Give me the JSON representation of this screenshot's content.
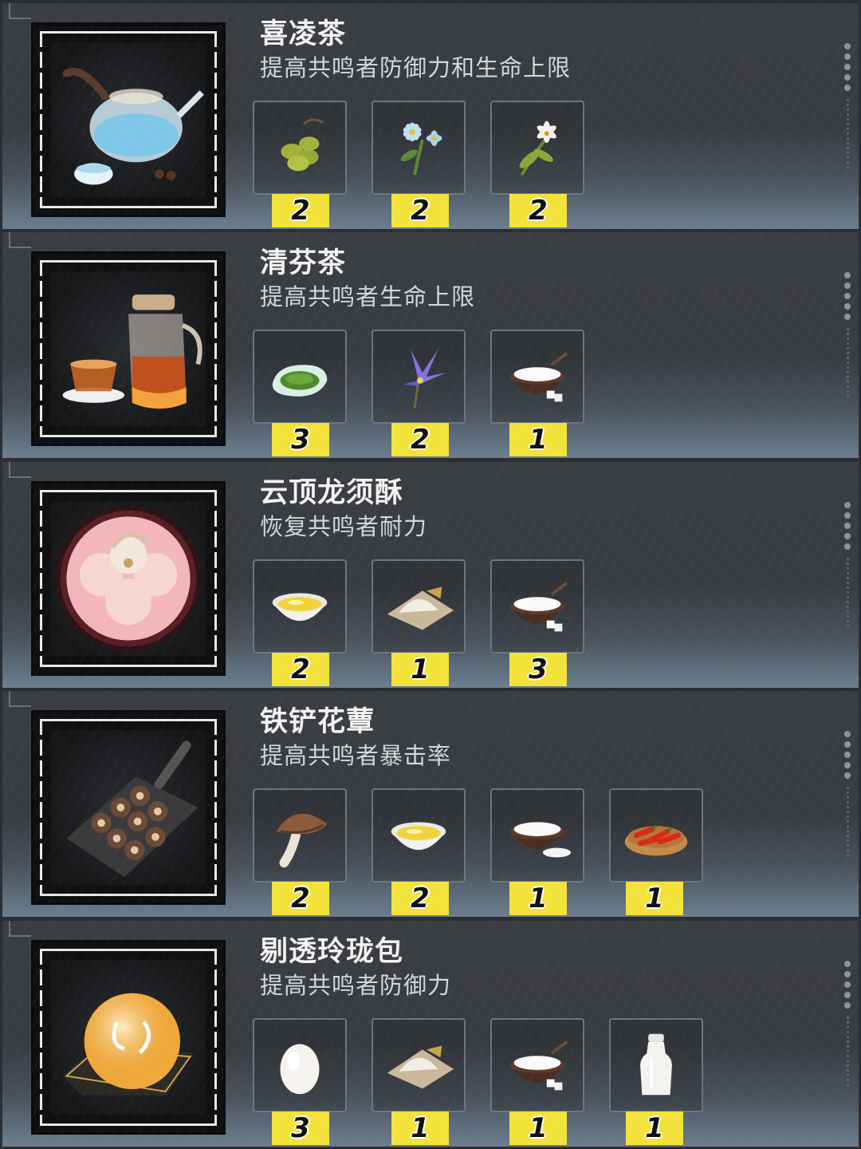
{
  "recipes": [
    {
      "title": "喜凌茶",
      "description": "提高共鸣者防御力和生命上限",
      "dish_icon": "teapot-icon",
      "ingredients": [
        {
          "icon": "green-olives-icon",
          "count": "2"
        },
        {
          "icon": "blue-flower-icon",
          "count": "2"
        },
        {
          "icon": "white-lily-icon",
          "count": "2"
        }
      ]
    },
    {
      "title": "清芬茶",
      "description": "提高共鸣者生命上限",
      "dish_icon": "glass-teapot-icon",
      "ingredients": [
        {
          "icon": "tea-leaves-icon",
          "count": "3"
        },
        {
          "icon": "purple-flower-icon",
          "count": "2"
        },
        {
          "icon": "sugar-bowl-icon",
          "count": "1"
        }
      ]
    },
    {
      "title": "云顶龙须酥",
      "description": "恢复共鸣者耐力",
      "dish_icon": "dragon-pastry-icon",
      "ingredients": [
        {
          "icon": "oil-bowl-icon",
          "count": "2"
        },
        {
          "icon": "flour-icon",
          "count": "1"
        },
        {
          "icon": "sugar-bowl-icon",
          "count": "3"
        }
      ]
    },
    {
      "title": "铁铲花蕈",
      "description": "提高共鸣者暴击率",
      "dish_icon": "shovel-mushroom-icon",
      "ingredients": [
        {
          "icon": "mushroom-icon",
          "count": "2"
        },
        {
          "icon": "oil-bowl-icon",
          "count": "2"
        },
        {
          "icon": "salt-bowl-icon",
          "count": "1"
        },
        {
          "icon": "chili-plate-icon",
          "count": "1"
        }
      ]
    },
    {
      "title": "剔透玲珑包",
      "description": "提高共鸣者防御力",
      "dish_icon": "crystal-bun-icon",
      "ingredients": [
        {
          "icon": "egg-icon",
          "count": "3"
        },
        {
          "icon": "flour-icon",
          "count": "1"
        },
        {
          "icon": "sugar-bowl-icon",
          "count": "1"
        },
        {
          "icon": "milk-bottle-icon",
          "count": "1"
        }
      ]
    }
  ]
}
